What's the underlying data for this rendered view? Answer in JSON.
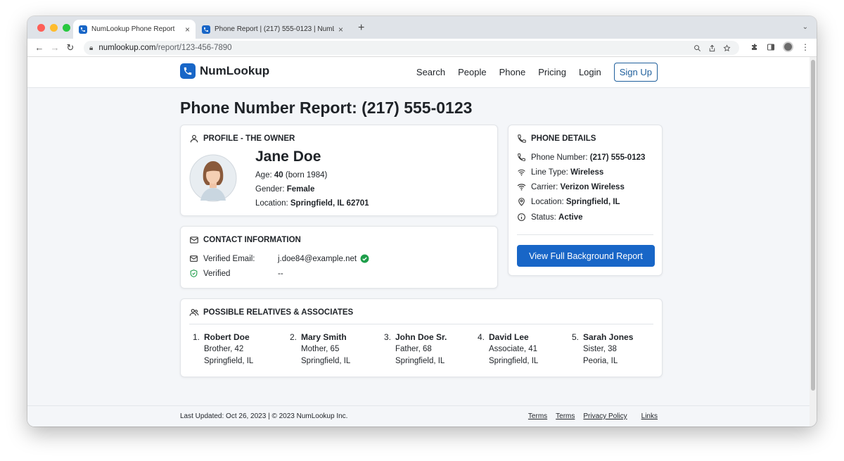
{
  "browser": {
    "tabs": [
      {
        "title": "NumLookup Phone Report",
        "active": true
      },
      {
        "title": "Phone Report | (217) 555-0123 | NumLookup",
        "active": false
      }
    ],
    "new_tab_symbol": "+",
    "url_domain": "numlookup.com",
    "url_path": "/report/123-456-7890"
  },
  "site": {
    "brand": "NumLookup",
    "nav": [
      "Search",
      "People",
      "Phone",
      "Pricing",
      "Login"
    ],
    "signup": "Sign Up"
  },
  "page": {
    "title": "Phone Number Report: (217) 555-0123"
  },
  "profile": {
    "heading": "PROFILE - THE OWNER",
    "name": "Jane Doe",
    "age_label": "Age:",
    "age_value": "40",
    "age_born": "(born 1984)",
    "gender_label": "Gender:",
    "gender_value": "Female",
    "location_label": "Location:",
    "location_value": "Springfield, IL 62701"
  },
  "contact": {
    "heading": "CONTACT INFORMATION",
    "email_label": "Verified Email:",
    "email_value": "j.doe84@example.net",
    "verified_label": "Verified",
    "verified_value": "--"
  },
  "phone_details": {
    "heading": "PHONE DETAILS",
    "rows": [
      {
        "icon": "phone-icon",
        "label": "Phone Number:",
        "value": "(217) 555-0123"
      },
      {
        "icon": "signal-icon",
        "label": "Line Type:",
        "value": "Wireless"
      },
      {
        "icon": "wifi-icon",
        "label": "Carrier:",
        "value": "Verizon Wireless"
      },
      {
        "icon": "location-pin-icon",
        "label": "Location:",
        "value": "Springfield, IL"
      },
      {
        "icon": "info-icon",
        "label": "Status:",
        "value": "Active"
      }
    ],
    "cta": "View Full Background Report"
  },
  "relatives": {
    "heading": "POSSIBLE RELATIVES & ASSOCIATES",
    "items": [
      {
        "num": "1.",
        "name": "Robert Doe",
        "relation": "Brother, 42",
        "city": "Springfield, IL"
      },
      {
        "num": "2.",
        "name": "Mary Smith",
        "relation": "Mother, 65",
        "city": "Springfield, IL"
      },
      {
        "num": "3.",
        "name": "John Doe Sr.",
        "relation": "Father, 68",
        "city": "Springfield, IL"
      },
      {
        "num": "4.",
        "name": "David Lee",
        "relation": "Associate, 41",
        "city": "Springfield, IL"
      },
      {
        "num": "5.",
        "name": "Sarah Jones",
        "relation": "Sister, 38",
        "city": "Peoria, IL"
      }
    ]
  },
  "footer": {
    "text": "Last Updated: Oct 26, 2023 | © 2023 NumLookup Inc.",
    "links": [
      "Terms",
      "Terms",
      "Privacy Policy",
      "Links"
    ]
  },
  "colors": {
    "brand_blue": "#1866c7",
    "verified_green": "#1e9e4a"
  }
}
